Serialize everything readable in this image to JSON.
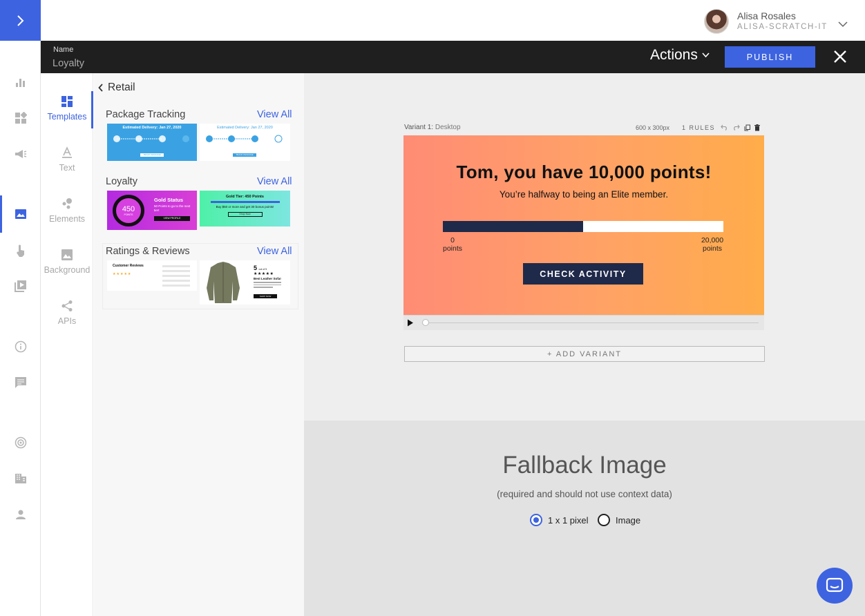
{
  "user": {
    "name": "Alisa Rosales",
    "org": "ALISA-SCRATCH-IT"
  },
  "header": {
    "name_label": "Name",
    "name_value": "Loyalty",
    "actions_label": "Actions",
    "publish_label": "PUBLISH"
  },
  "tools": [
    {
      "label": "Templates",
      "icon": "templates-icon"
    },
    {
      "label": "Text",
      "icon": "text-icon"
    },
    {
      "label": "Elements",
      "icon": "elements-icon"
    },
    {
      "label": "Background",
      "icon": "background-icon"
    },
    {
      "label": "APIs",
      "icon": "share-icon"
    }
  ],
  "panel": {
    "back_label": "Retail",
    "sections": [
      {
        "title": "Package Tracking",
        "view_all": "View All",
        "thumbs": [
          {
            "heading": "Estimated Delivery: Jan 27, 2020",
            "button": "TRACK PACKAGE"
          },
          {
            "heading": "Estimated Delivery: Jan 27, 2020",
            "button": "TRACK PACKAGE"
          }
        ]
      },
      {
        "title": "Loyalty",
        "view_all": "View All",
        "thumbs": [
          {
            "points": "450",
            "points_unit": "POINTS",
            "heading": "Gold Status",
            "body": "50 Points to go to the next tier!",
            "button": "VIEW PROFILE"
          },
          {
            "heading": "Gold Tier: 450 Points",
            "body": "Buy $50 or more and get 30 bonus points!",
            "button": "Shop Now"
          }
        ]
      },
      {
        "title": "Ratings & Reviews",
        "view_all": "View All",
        "thumbs": [
          {
            "heading": "Customer Reviews"
          },
          {
            "rating": "5",
            "rating_suffix": "out of 5",
            "stars": "★★★★★",
            "heading": "Best Leather Sofa!",
            "button": "SHOP NOW"
          }
        ]
      }
    ]
  },
  "variant": {
    "label": "Variant 1:",
    "platform": "Desktop",
    "size": "600 x 300px",
    "rules": "1 RULES"
  },
  "banner": {
    "title": "Tom, you have 10,000 points!",
    "subtitle": "You’re halfway to being an Elite member.",
    "progress": {
      "value": 10000,
      "max": 20000,
      "min_value": "0",
      "min_unit": "points",
      "max_value": "20,000",
      "max_unit": "points"
    },
    "cta": "CHECK ACTIVITY",
    "colors": {
      "gradient_start": "#ff8c75",
      "gradient_end": "#ffac4a",
      "dark": "#1f2a4a"
    }
  },
  "add_variant": "+ ADD VARIANT",
  "fallback": {
    "title": "Fallback Image",
    "subtitle": "(required and should not use context data)",
    "options": [
      {
        "label": "1 x 1 pixel",
        "selected": true
      },
      {
        "label": "Image",
        "selected": false
      }
    ]
  },
  "accent": "#3d63e0"
}
